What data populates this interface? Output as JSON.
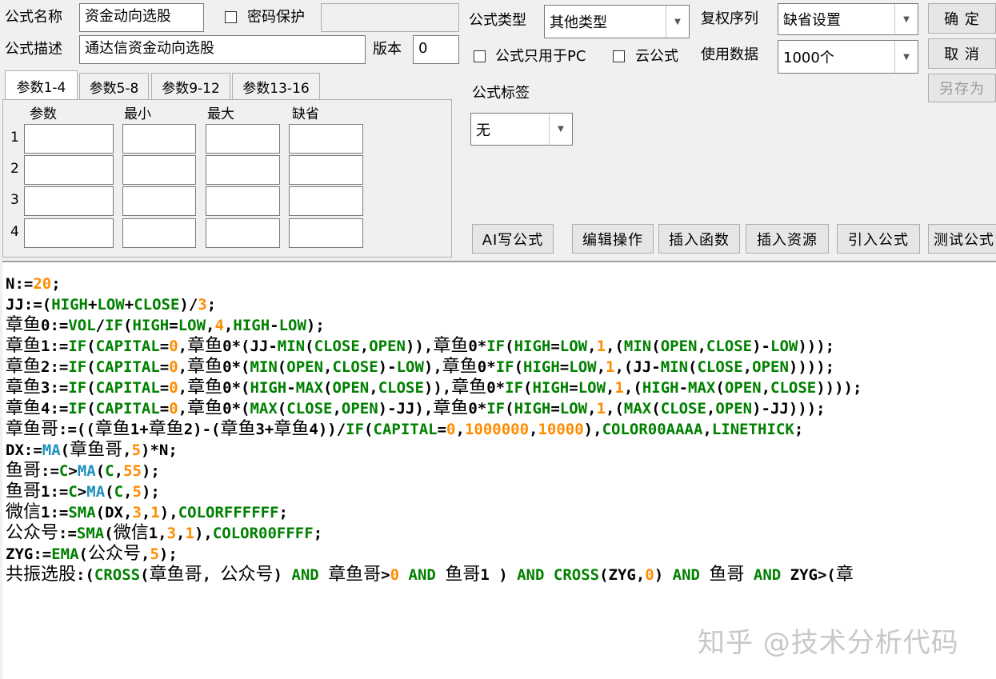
{
  "top": {
    "formula_name_label": "公式名称",
    "formula_name_value": "资金动向选股",
    "password_label": "密码保护",
    "desc_label": "公式描述",
    "desc_value": "通达信资金动向选股",
    "version_label": "版本",
    "version_value": "0",
    "type_label": "公式类型",
    "type_value": "其他类型",
    "adjust_label": "复权序列",
    "adjust_value": "缺省设置",
    "pc_only_label": "公式只用于PC",
    "cloud_label": "云公式",
    "data_label": "使用数据",
    "data_value": "1000个",
    "tag_label": "公式标签",
    "tag_value": "无"
  },
  "buttons": {
    "ok": "确 定",
    "cancel": "取 消",
    "save_as": "另存为",
    "ai": "AI写公式",
    "edit": "编辑操作",
    "insert_func": "插入函数",
    "insert_res": "插入资源",
    "import": "引入公式",
    "test": "测试公式"
  },
  "tabs": [
    "参数1-4",
    "参数5-8",
    "参数9-12",
    "参数13-16"
  ],
  "param_headers": [
    "参数",
    "最小",
    "最大",
    "缺省"
  ],
  "param_rows": [
    "1",
    "2",
    "3",
    "4"
  ],
  "code_lines": [
    "N:=20;",
    "JJ:=(HIGH+LOW+CLOSE)/3;",
    "章鱼0:=VOL/IF(HIGH=LOW,4,HIGH-LOW);",
    "章鱼1:=IF(CAPITAL=0,章鱼0*(JJ-MIN(CLOSE,OPEN)),章鱼0*IF(HIGH=LOW,1,(MIN(OPEN,CLOSE)-LOW)));",
    "章鱼2:=IF(CAPITAL=0,章鱼0*(MIN(OPEN,CLOSE)-LOW),章鱼0*IF(HIGH=LOW,1,(JJ-MIN(CLOSE,OPEN))));",
    "章鱼3:=IF(CAPITAL=0,章鱼0*(HIGH-MAX(OPEN,CLOSE)),章鱼0*IF(HIGH=LOW,1,(HIGH-MAX(OPEN,CLOSE))));",
    "章鱼4:=IF(CAPITAL=0,章鱼0*(MAX(CLOSE,OPEN)-JJ),章鱼0*IF(HIGH=LOW,1,(MAX(CLOSE,OPEN)-JJ)));",
    "章鱼哥:=((章鱼1+章鱼2)-(章鱼3+章鱼4))/IF(CAPITAL=0,1000000,10000),COLOR00AAAA,LINETHICK;",
    "DX:=MA(章鱼哥,5)*N;",
    "鱼哥:=C>MA(C,55);",
    "鱼哥1:=C>MA(C,5);",
    "微信1:=SMA(DX,3,1),COLORFFFFFF;",
    "公众号:=SMA(微信1,3,1),COLOR00FFFF;",
    "ZYG:=EMA(公众号,5);",
    "共振选股:(CROSS(章鱼哥, 公众号) AND 章鱼哥>0 AND 鱼哥1 ) AND CROSS(ZYG,0) AND 鱼哥 AND ZYG>(章"
  ],
  "watermark": "知乎 @技术分析代码"
}
